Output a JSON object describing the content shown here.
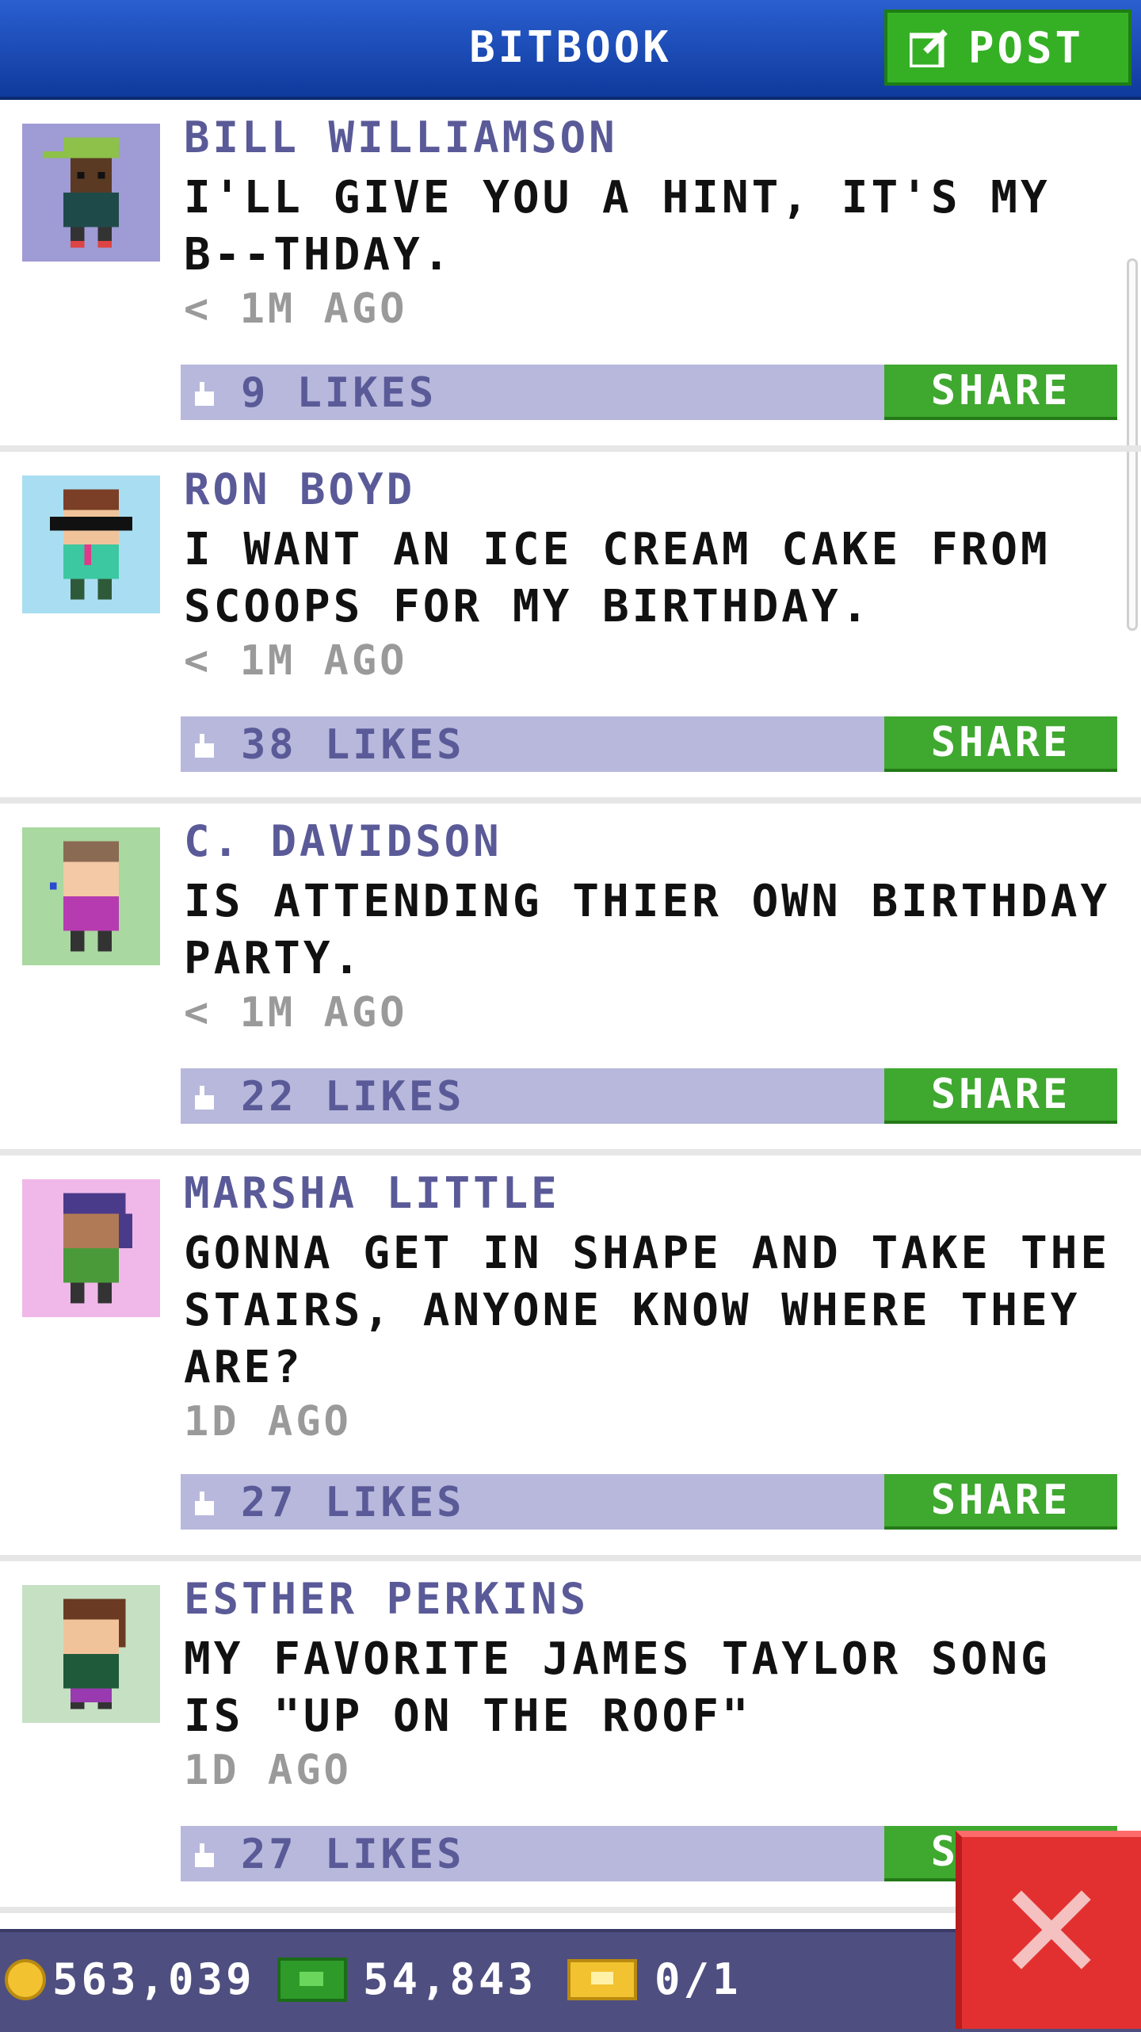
{
  "header": {
    "title": "BITBOOK",
    "post_label": "POST"
  },
  "posts": [
    {
      "author": "BILL WILLIAMSON",
      "message": "I'LL GIVE YOU A HINT, IT'S MY B--THDAY.",
      "time": "< 1M AGO",
      "likes": "9 LIKES",
      "share": "SHARE"
    },
    {
      "author": "RON BOYD",
      "message": "I WANT AN ICE CREAM CAKE FROM SCOOPS FOR MY BIRTHDAY.",
      "time": "< 1M AGO",
      "likes": "38 LIKES",
      "share": "SHARE"
    },
    {
      "author": "C. DAVIDSON",
      "message": "IS ATTENDING THIER OWN BIRTHDAY PARTY.",
      "time": "< 1M AGO",
      "likes": "22 LIKES",
      "share": "SHARE"
    },
    {
      "author": "MARSHA LITTLE",
      "message": "GONNA GET IN SHAPE AND TAKE THE STAIRS, ANYONE KNOW WHERE THEY ARE?",
      "time": "1D AGO",
      "likes": "27 LIKES",
      "share": "SHARE"
    },
    {
      "author": "ESTHER PERKINS",
      "message": "MY FAVORITE JAMES TAYLOR SONG IS \"UP ON THE ROOF\"",
      "time": "1D AGO",
      "likes": "27 LIKES",
      "share": "SHARE"
    }
  ],
  "bottom_bar": {
    "coins": "563,039",
    "bux": "54,843",
    "tickets": "0/1"
  },
  "colors": {
    "header": "#1a4cc0",
    "share": "#3fa82f",
    "like_bar": "#b8b8dc",
    "author": "#5a5a98",
    "close": "#e23030"
  }
}
